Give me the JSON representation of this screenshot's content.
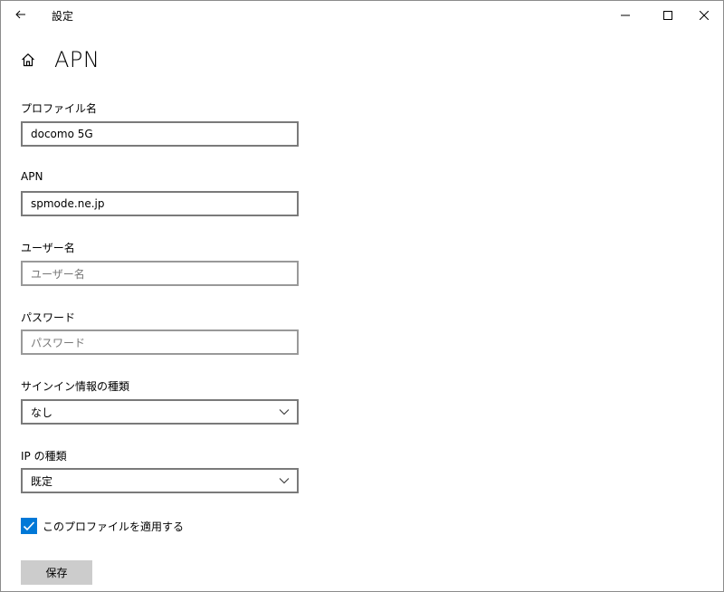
{
  "window": {
    "title": "設定",
    "back_icon": "arrow-left-icon",
    "minimize_icon": "minimize-icon",
    "maximize_icon": "maximize-icon",
    "close_icon": "close-icon"
  },
  "header": {
    "home_icon": "home-icon",
    "title": "APN"
  },
  "form": {
    "profile_name": {
      "label": "プロファイル名",
      "value": "docomo 5G"
    },
    "apn": {
      "label": "APN",
      "value": "spmode.ne.jp"
    },
    "username": {
      "label": "ユーザー名",
      "placeholder": "ユーザー名"
    },
    "password": {
      "label": "パスワード",
      "placeholder": "パスワード"
    },
    "signin_type": {
      "label": "サインイン情報の種類",
      "value": "なし"
    },
    "ip_type": {
      "label": "IP の種類",
      "value": "既定"
    },
    "apply_profile": {
      "label": "このプロファイルを適用する",
      "checked": true
    },
    "save_label": "保存"
  },
  "colors": {
    "accent": "#0078d7",
    "button_bg": "#cccccc",
    "border": "#7a7a7a"
  }
}
